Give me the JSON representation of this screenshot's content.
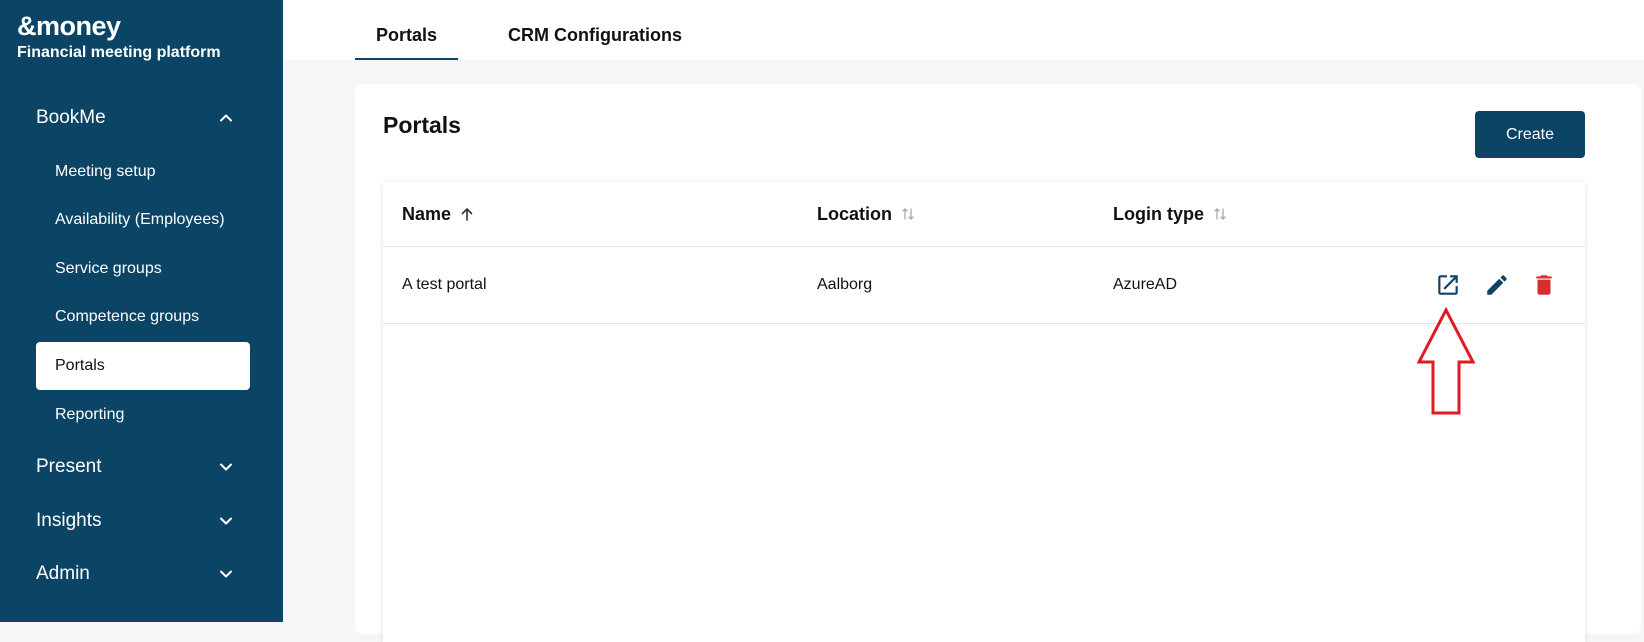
{
  "brand": {
    "logo": "&money",
    "subtitle": "Financial meeting platform"
  },
  "sidebar": {
    "sections": [
      {
        "label": "BookMe",
        "expanded": true
      },
      {
        "label": "Present",
        "expanded": false
      },
      {
        "label": "Insights",
        "expanded": false
      },
      {
        "label": "Admin",
        "expanded": false
      }
    ],
    "items": [
      {
        "label": "Meeting setup"
      },
      {
        "label": "Availability (Employees)"
      },
      {
        "label": "Service groups"
      },
      {
        "label": "Competence groups"
      },
      {
        "label": "Portals",
        "active": true
      },
      {
        "label": "Reporting"
      }
    ]
  },
  "tabs": [
    {
      "label": "Portals",
      "active": true
    },
    {
      "label": "CRM Configurations",
      "active": false
    }
  ],
  "main": {
    "title": "Portals",
    "create_label": "Create",
    "table": {
      "columns": [
        {
          "label": "Name",
          "sort": "ascending"
        },
        {
          "label": "Location",
          "sort": "none"
        },
        {
          "label": "Login type",
          "sort": "none"
        }
      ],
      "rows": [
        {
          "name": "A test portal",
          "location": "Aalborg",
          "login_type": "AzureAD"
        }
      ],
      "row_actions": [
        "open-external-icon",
        "edit-icon",
        "delete-icon"
      ]
    }
  },
  "colors": {
    "sidebar_bg": "#0c4466",
    "primary": "#0c4466",
    "delete": "#d32f2f",
    "annotation": "#e01b24",
    "page_bg": "#f5f6f7"
  }
}
